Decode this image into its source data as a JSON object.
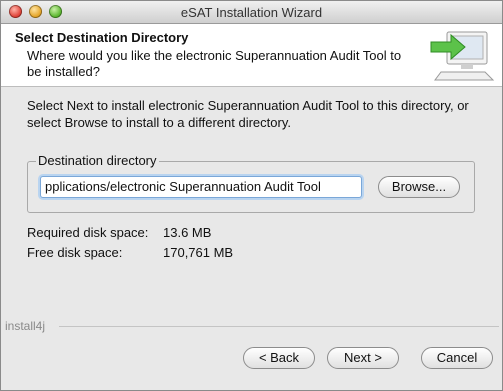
{
  "window": {
    "title": "eSAT Installation Wizard"
  },
  "header": {
    "title": "Select Destination Directory",
    "subtitle": "Where would you like the electronic Superannuation Audit Tool to be installed?",
    "graphic_icon": "installer-computer-icon"
  },
  "intro": "Select Next to install electronic Superannuation Audit Tool to this directory, or select Browse to install to a different directory.",
  "destination": {
    "legend": "Destination directory",
    "path": "pplications/electronic Superannuation Audit Tool",
    "browse_label": "Browse..."
  },
  "disk": {
    "required_label": "Required disk space:",
    "required_value": "13.6 MB",
    "free_label": "Free disk space:",
    "free_value": "170,761 MB"
  },
  "footer": {
    "brand": "install4j",
    "back_label": "< Back",
    "next_label": "Next >",
    "cancel_label": "Cancel"
  }
}
